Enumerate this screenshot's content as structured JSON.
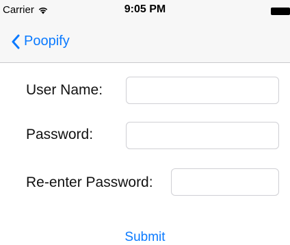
{
  "status_bar": {
    "carrier": "Carrier",
    "wifi_icon": "wifi-icon",
    "time": "9:05 PM",
    "battery_icon": "battery-icon"
  },
  "nav_bar": {
    "back_icon": "chevron-left-icon",
    "back_label": "Poopify"
  },
  "form": {
    "username_label": "User Name:",
    "username_value": "",
    "password_label": "Password:",
    "password_value": "",
    "reenter_label": "Re-enter Password:",
    "reenter_value": ""
  },
  "actions": {
    "submit_label": "Submit"
  },
  "colors": {
    "accent": "#0a7aff",
    "navbar_bg": "#f7f7f7"
  }
}
